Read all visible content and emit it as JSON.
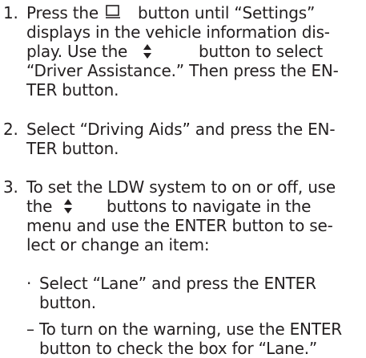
{
  "steps": [
    {
      "number": "1.",
      "lines": [
        "Press the",
        "button until “Settings”",
        "displays in the vehicle information dis-",
        "play. Use the",
        "button to select",
        "“Driver Assistance.” Then press the EN-",
        "TER button."
      ],
      "icons": [
        "display-toggle-icon",
        "up-down-arrows-icon"
      ]
    },
    {
      "number": "2.",
      "lines": [
        "Select “Driving Aids” and press the EN-",
        "TER button."
      ]
    },
    {
      "number": "3.",
      "lines": [
        "To set the LDW system to on or off, use",
        "the",
        "buttons to navigate in the",
        "menu and use the ENTER button to se-",
        "lect or change an item:"
      ],
      "icons": [
        "up-down-arrows-icon"
      ],
      "substeps": [
        {
          "marker": "·",
          "lines": [
            "Select “Lane” and press the ENTER",
            "button."
          ]
        },
        {
          "marker": "–",
          "lines": [
            "To turn on the warning, use the ENTER",
            "button to check the box for “Lane.”"
          ]
        }
      ]
    }
  ]
}
